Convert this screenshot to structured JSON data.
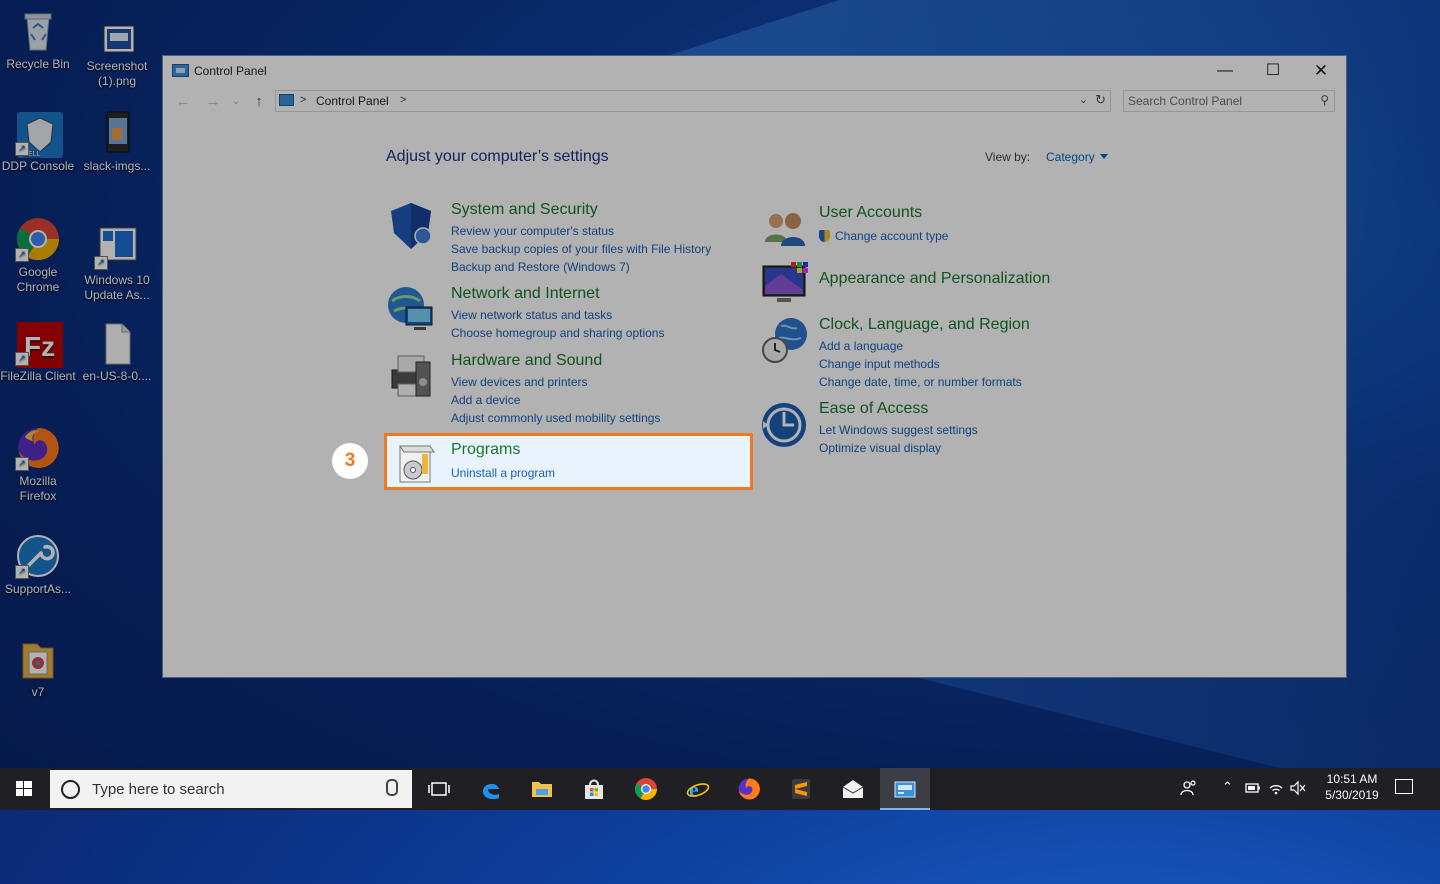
{
  "desktop": {
    "icons": [
      {
        "label": "Recycle Bin"
      },
      {
        "label": "Screenshot (1).png"
      },
      {
        "label": "DDP Console"
      },
      {
        "label": "slack-imgs..."
      },
      {
        "label": "Google Chrome"
      },
      {
        "label": "Windows 10 Update As..."
      },
      {
        "label": "FileZilla Client"
      },
      {
        "label": "en-US-8-0...."
      },
      {
        "label": "Mozilla Firefox"
      },
      {
        "label": "SupportAs..."
      },
      {
        "label": "v7"
      }
    ]
  },
  "window": {
    "title": "Control Panel",
    "address": {
      "breadcrumb": "Control Panel",
      "sep": ">"
    },
    "search": {
      "placeholder": "Search Control Panel"
    },
    "heading": "Adjust your computer’s settings",
    "view_by_label": "View by:",
    "view_by_value": "Category",
    "categories_left": [
      {
        "title": "System and Security",
        "links": [
          "Review your computer's status",
          "Save backup copies of your files with File History",
          "Backup and Restore (Windows 7)"
        ],
        "icon": "shield-icon"
      },
      {
        "title": "Network and Internet",
        "links": [
          "View network status and tasks",
          "Choose homegroup and sharing options"
        ],
        "icon": "network-icon"
      },
      {
        "title": "Hardware and Sound",
        "links": [
          "View devices and printers",
          "Add a device",
          "Adjust commonly used mobility settings"
        ],
        "icon": "printer-icon"
      },
      {
        "title": "Programs",
        "links": [
          "Uninstall a program"
        ],
        "icon": "programs-icon"
      }
    ],
    "categories_right": [
      {
        "title": "User Accounts",
        "links": [
          "Change account type"
        ],
        "icon": "users-icon"
      },
      {
        "title": "Appearance and Personalization",
        "links": [],
        "icon": "monitor-icon"
      },
      {
        "title": "Clock, Language, and Region",
        "links": [
          "Add a language",
          "Change input methods",
          "Change date, time, or number formats"
        ],
        "icon": "clock-globe-icon"
      },
      {
        "title": "Ease of Access",
        "links": [
          "Let Windows suggest settings",
          "Optimize visual display"
        ],
        "icon": "ease-of-access-icon"
      }
    ]
  },
  "annotation": {
    "step": "3",
    "accent": "#f07a22"
  },
  "taskbar": {
    "search_placeholder": "Type here to search",
    "time": "10:51 AM",
    "date": "5/30/2019"
  }
}
